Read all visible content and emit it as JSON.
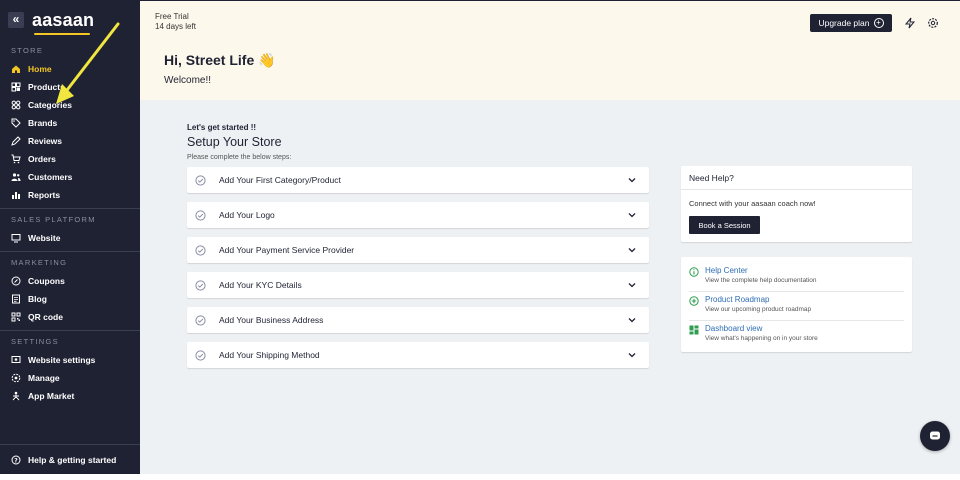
{
  "brand": {
    "name": "aasaan",
    "accent": "#f3c623",
    "sidebar_bg": "#1f2233"
  },
  "sidebar": {
    "sections": [
      {
        "title": "STORE",
        "items": [
          {
            "label": "Home",
            "icon": "home-icon",
            "active": true
          },
          {
            "label": "Products",
            "icon": "products-icon"
          },
          {
            "label": "Categories",
            "icon": "categories-icon"
          },
          {
            "label": "Brands",
            "icon": "tag-icon"
          },
          {
            "label": "Reviews",
            "icon": "reviews-icon"
          },
          {
            "label": "Orders",
            "icon": "cart-icon"
          },
          {
            "label": "Customers",
            "icon": "customers-icon"
          },
          {
            "label": "Reports",
            "icon": "reports-icon"
          }
        ]
      },
      {
        "title": "SALES PLATFORM",
        "items": [
          {
            "label": "Website",
            "icon": "monitor-icon"
          }
        ]
      },
      {
        "title": "MARKETING",
        "items": [
          {
            "label": "Coupons",
            "icon": "coupon-icon"
          },
          {
            "label": "Blog",
            "icon": "blog-icon"
          },
          {
            "label": "QR code",
            "icon": "qr-icon"
          }
        ]
      },
      {
        "title": "SETTINGS",
        "items": [
          {
            "label": "Website settings",
            "icon": "website-settings-icon"
          },
          {
            "label": "Manage",
            "icon": "manage-icon"
          },
          {
            "label": "App Market",
            "icon": "app-market-icon"
          }
        ]
      }
    ],
    "footer": {
      "label": "Help & getting started",
      "icon": "help-icon"
    }
  },
  "topbar": {
    "trial_label": "Free Trial",
    "trial_days": "14 days left",
    "upgrade_label": "Upgrade plan"
  },
  "greeting": {
    "title": "Hi, Street Life 👋",
    "subtitle": "Welcome!!"
  },
  "setup": {
    "pre": "Let's get started !!",
    "title": "Setup Your Store",
    "note": "Please complete the below steps:",
    "steps": [
      "Add Your First Category/Product",
      "Add Your Logo",
      "Add Your Payment Service Provider",
      "Add Your KYC Details",
      "Add Your Business Address",
      "Add Your Shipping Method"
    ]
  },
  "help": {
    "title": "Need Help?",
    "text": "Connect with your aasaan coach now!",
    "button": "Book a Session"
  },
  "links": [
    {
      "title": "Help Center",
      "desc": "View the complete help documentation",
      "icon": "info-icon",
      "color": "#2e9e4f"
    },
    {
      "title": "Product Roadmap",
      "desc": "View our upcoming product roadmap",
      "icon": "plus-circle-icon",
      "color": "#2e9e4f"
    },
    {
      "title": "Dashboard view",
      "desc": "View what's happening on in your store",
      "icon": "dashboard-icon",
      "color": "#2e9e4f"
    }
  ]
}
